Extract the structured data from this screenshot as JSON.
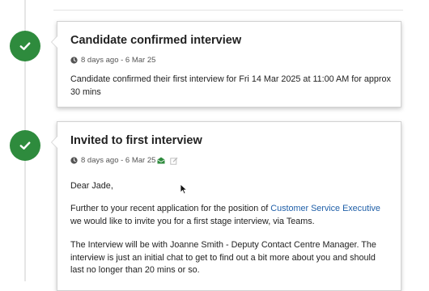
{
  "timeline": [
    {
      "title": "Candidate confirmed interview",
      "meta": "8 days ago - 6 Mar 25",
      "body": "Candidate confirmed their first interview for Fri 14 Mar 2025 at 11:00 AM for approx 30 mins"
    },
    {
      "title": "Invited to first interview",
      "meta": "8 days ago - 6 Mar 25",
      "greeting": "Dear Jade,",
      "para1_before": "Further to your recent application for the position of ",
      "para1_link": "Customer Service Executive",
      "para1_after": " we would like to invite you for a first stage interview, via Teams.",
      "para2": "The Interview will be with Joanne Smith - Deputy Contact Centre Manager. The interview is just an initial chat to get to find out a bit more about you and should last no longer than 20 mins or so."
    }
  ],
  "colors": {
    "success": "#2e8b3d",
    "link": "#1f5fa8",
    "mail_icon": "#2e8b3d"
  },
  "icons": {
    "node": "check-circle-icon",
    "meta": "clock-icon",
    "mail": "email-icon",
    "edit": "edit-icon"
  }
}
